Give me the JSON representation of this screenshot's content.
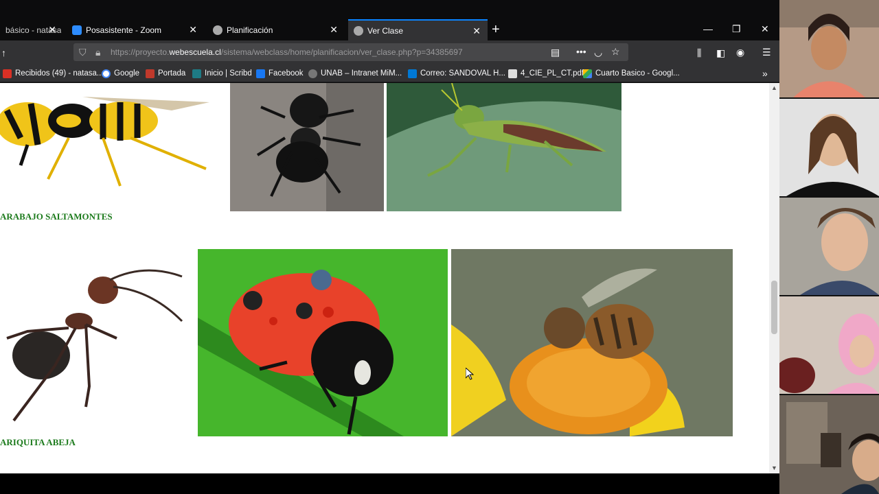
{
  "browser": {
    "tabs": [
      {
        "title": "básico - natasa",
        "active": false
      },
      {
        "title": "Posasistente - Zoom",
        "active": false
      },
      {
        "title": "Planificación",
        "active": false
      },
      {
        "title": "Ver Clase",
        "active": true
      }
    ],
    "url_prefix": "https://proyecto.",
    "url_domain": "webescuela.cl",
    "url_path": "/sistema/webclass/home/planificacion/ver_clase.php?p=34385697",
    "bookmarks": [
      "Recibidos (49) - natasa...",
      "Google",
      "Portada",
      "Inicio | Scribd",
      "Facebook",
      "UNAB – Intranet MiM...",
      "Correo: SANDOVAL H...",
      "4_CIE_PL_CT.pdf",
      "Cuarto Basico - Googl..."
    ]
  },
  "page": {
    "caption_row1": "ARABAJO SALTAMONTES",
    "caption_row2": "ARIQUITA ABEJA"
  },
  "colors": {
    "accent": "#0a84ff",
    "caption": "#1b7a1b",
    "toolbar": "#323234"
  },
  "icons": [
    "close-icon",
    "plus-icon",
    "minimize-icon",
    "restore-icon",
    "shield-icon",
    "lock-icon",
    "reader-icon",
    "menu-icon",
    "star-icon",
    "pocket-icon",
    "library-icon",
    "sidebar-icon",
    "account-icon",
    "hamburger-icon",
    "chevron-double-right-icon"
  ]
}
